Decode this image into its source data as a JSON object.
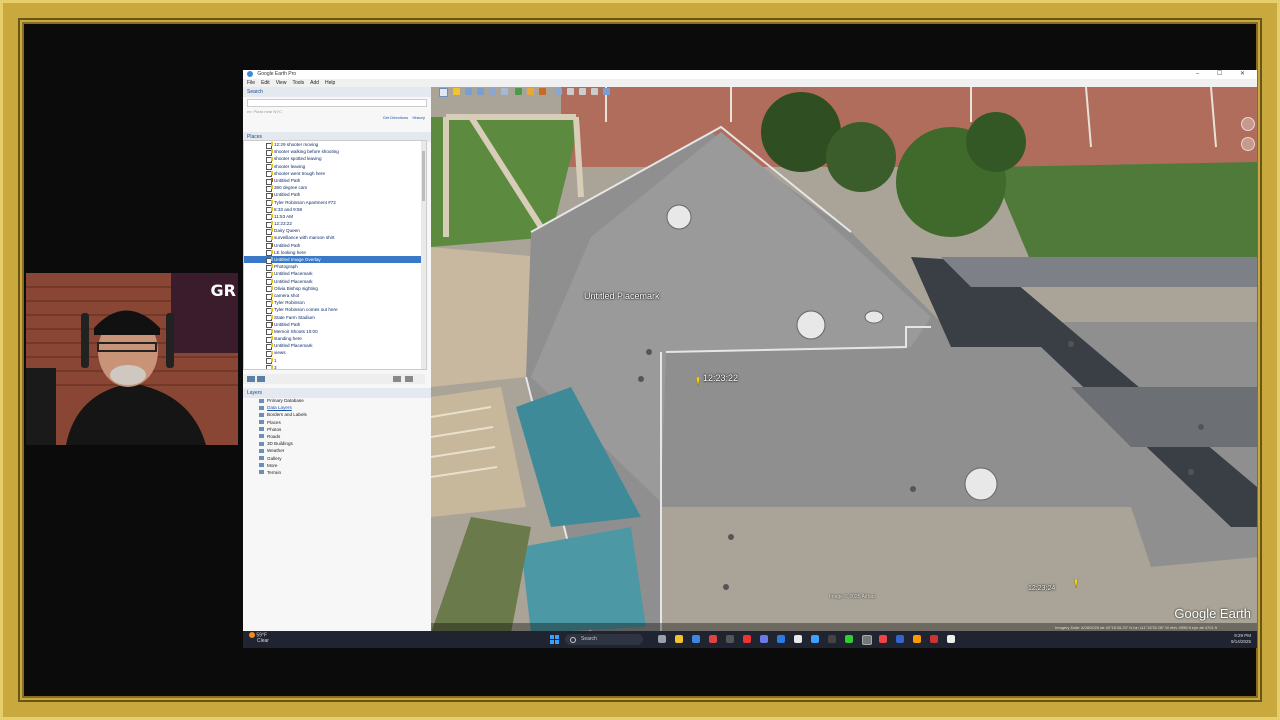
{
  "window": {
    "title": "Google Earth Pro",
    "menu": [
      "File",
      "Edit",
      "View",
      "Tools",
      "Add",
      "Help"
    ],
    "controls": "– ☐ ✕"
  },
  "search": {
    "header": "Search",
    "placeholder": "",
    "button": "Search",
    "hint": "ex: Pizza near NYC",
    "links": [
      "Get Directions",
      "History"
    ]
  },
  "places": {
    "header": "Places",
    "items": [
      {
        "label": "12:29 shooter moving",
        "type": "pin"
      },
      {
        "label": "shooter walking before shooting",
        "type": "pin"
      },
      {
        "label": "shooter spotted leaving",
        "type": "pin"
      },
      {
        "label": "shooter leaving",
        "type": "pin"
      },
      {
        "label": "shooter went trough here",
        "type": "pin"
      },
      {
        "label": "Untitled Path",
        "type": "path"
      },
      {
        "label": "360 degree cam",
        "type": "pin"
      },
      {
        "label": "Untitled Path",
        "type": "path"
      },
      {
        "label": "Tyler Robinson Apartment #72",
        "type": "pin"
      },
      {
        "label": "8:33 and 9:58",
        "type": "pin"
      },
      {
        "label": "11:53 AM",
        "type": "pin"
      },
      {
        "label": "12:23:22",
        "type": "pin"
      },
      {
        "label": "Dairy Queen",
        "type": "pin"
      },
      {
        "label": "surveillance with maroon shirt",
        "type": "pin"
      },
      {
        "label": "Untitled Path",
        "type": "path"
      },
      {
        "label": "LE looking here",
        "type": "pin"
      },
      {
        "label": "Untitled Image Overlay",
        "type": "overlay",
        "selected": true
      },
      {
        "label": "Photograph",
        "type": "pin"
      },
      {
        "label": "Untitled Placemark",
        "type": "pin"
      },
      {
        "label": "Untitled Placemark",
        "type": "pin"
      },
      {
        "label": "Olivia Bishop sighting",
        "type": "pin"
      },
      {
        "label": "camera shot",
        "type": "pin"
      },
      {
        "label": "Tyler Robinson",
        "type": "pin"
      },
      {
        "label": "Tyler Robinson comes out here",
        "type": "pin"
      },
      {
        "label": "State Farm Stadium",
        "type": "pin"
      },
      {
        "label": "Untitled Path",
        "type": "path"
      },
      {
        "label": "Memoir Shoots 10:00",
        "type": "pin"
      },
      {
        "label": "standing here",
        "type": "pin"
      },
      {
        "label": "Untitled Placemark",
        "type": "pin"
      },
      {
        "label": "views",
        "type": "folder"
      },
      {
        "label": "1",
        "type": "pin"
      },
      {
        "label": "3",
        "type": "pin"
      }
    ]
  },
  "layers": {
    "header": "Layers",
    "items": [
      {
        "label": "Primary Database",
        "link": false
      },
      {
        "label": "Data Layers",
        "link": true
      },
      {
        "label": "Borders and Labels",
        "link": false
      },
      {
        "label": "Places",
        "link": false
      },
      {
        "label": "Photos",
        "link": false
      },
      {
        "label": "Roads",
        "link": false
      },
      {
        "label": "3D Buildings",
        "link": false
      },
      {
        "label": "Weather",
        "link": false
      },
      {
        "label": "Gallery",
        "link": false
      },
      {
        "label": "More",
        "link": false
      },
      {
        "label": "Terrain",
        "link": false
      }
    ]
  },
  "map": {
    "placemark_label": "Untitled Placemark",
    "pin_label_1": "12:23:22",
    "pin_label_2": "12:23:24",
    "overlay_small_label": "Image © 2025 Airbus",
    "watermark": "Google Earth",
    "status": "Imagery Date: 8/28/2025   lat 40°16'45.23\" N  lon 111°42'52.08\" W  elev 4596 ft  eye alt 4701 ft"
  },
  "taskbar": {
    "weather_temp": "59°F",
    "weather_desc": "Clear",
    "search_label": "Search",
    "time": "9:29 PM",
    "date": "9/14/2025"
  },
  "overlay_brand": "GR"
}
